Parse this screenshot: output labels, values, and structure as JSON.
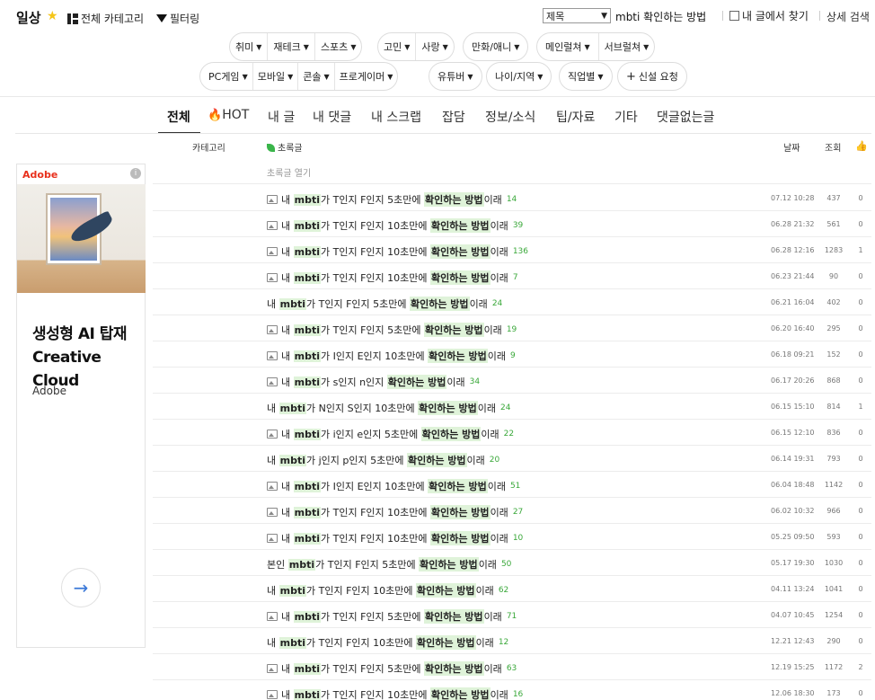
{
  "header": {
    "board_title": "일상",
    "all_categories": "전체 카테고리",
    "filter": "필터링",
    "search_field": "제목",
    "search_query": "mbti 확인하는 방법",
    "search_in_my_posts": "내 글에서 찾기",
    "advanced_search": "상세 검색"
  },
  "categories_row1": {
    "group1": [
      "취미",
      "재테크",
      "스포츠"
    ],
    "group2": [
      "고민",
      "사랑"
    ],
    "group3": [
      "만화/애니"
    ],
    "group4": [
      "메인럴쳐",
      "서브럴쳐"
    ]
  },
  "categories_row2": {
    "group1": [
      "PC게임",
      "모바일",
      "콘솔",
      "프로게이머"
    ],
    "group2": [
      "유튜버"
    ],
    "group3": [
      "나이/지역"
    ],
    "group4": [
      "직업별"
    ],
    "request": "신설 요청"
  },
  "tabs": [
    "전체",
    "HOT",
    "내 글",
    "내 댓글",
    "내 스크랩",
    "잡담",
    "정보/소식",
    "팁/자료",
    "기타",
    "댓글없는글"
  ],
  "list_header": {
    "category": "카테고리",
    "title": "초록글",
    "date": "날짜",
    "views": "조회"
  },
  "preview_toggle": "초록글 열기",
  "ad": {
    "logo": "Adobe",
    "info": "i",
    "headline": "생성형 AI 탑재 Creative Cloud",
    "brand": "Adobe",
    "arrow": "→"
  },
  "posts": [
    {
      "img": true,
      "pre": "내 ",
      "hl1": "mbti",
      "mid": "가 T인지 F인지 5초만에 ",
      "hl2": "확인하는 방법",
      "post": "이래",
      "comments": "14",
      "date": "07.12 10:28",
      "views": "437",
      "likes": "0"
    },
    {
      "img": true,
      "pre": "내 ",
      "hl1": "mbti",
      "mid": "가 T인지 F인지 10초만에 ",
      "hl2": "확인하는 방법",
      "post": "이래",
      "comments": "39",
      "date": "06.28 21:32",
      "views": "561",
      "likes": "0"
    },
    {
      "img": true,
      "pre": "내 ",
      "hl1": "mbti",
      "mid": "가 T인지 F인지 10초만에 ",
      "hl2": "확인하는 방법",
      "post": "이래",
      "comments": "136",
      "date": "06.28 12:16",
      "views": "1283",
      "likes": "1"
    },
    {
      "img": true,
      "pre": "내 ",
      "hl1": "mbti",
      "mid": "가 T인지 F인지 10초만에 ",
      "hl2": "확인하는 방법",
      "post": "이래",
      "comments": "7",
      "date": "06.23 21:44",
      "views": "90",
      "likes": "0"
    },
    {
      "img": false,
      "pre": "내 ",
      "hl1": "mbti",
      "mid": "가 T인지 F인지 5초만에 ",
      "hl2": "확인하는 방법",
      "post": "이래",
      "comments": "24",
      "date": "06.21 16:04",
      "views": "402",
      "likes": "0"
    },
    {
      "img": true,
      "pre": "내 ",
      "hl1": "mbti",
      "mid": "가 T인지 F인지 5초만에 ",
      "hl2": "확인하는 방법",
      "post": "이래",
      "comments": "19",
      "date": "06.20 16:40",
      "views": "295",
      "likes": "0"
    },
    {
      "img": true,
      "pre": "내 ",
      "hl1": "mbti",
      "mid": "가 I인지 E인지 10초만에 ",
      "hl2": "확인하는 방법",
      "post": "이래",
      "comments": "9",
      "date": "06.18 09:21",
      "views": "152",
      "likes": "0"
    },
    {
      "img": true,
      "pre": "내 ",
      "hl1": "mbti",
      "mid": "가 s인지 n인지 ",
      "hl2": "확인하는 방법",
      "post": "이래",
      "comments": "34",
      "date": "06.17 20:26",
      "views": "868",
      "likes": "0"
    },
    {
      "img": false,
      "pre": "내 ",
      "hl1": "mbti",
      "mid": "가 N인지 S인지 10초만에 ",
      "hl2": "확인하는 방법",
      "post": "이래",
      "comments": "24",
      "date": "06.15 15:10",
      "views": "814",
      "likes": "1"
    },
    {
      "img": true,
      "pre": "내 ",
      "hl1": "mbti",
      "mid": "가 i인지 e인지 5초만에 ",
      "hl2": "확인하는 방법",
      "post": "이래",
      "comments": "22",
      "date": "06.15 12:10",
      "views": "836",
      "likes": "0"
    },
    {
      "img": false,
      "pre": "내 ",
      "hl1": "mbti",
      "mid": "가 j인지 p인지 5초만에 ",
      "hl2": "확인하는 방법",
      "post": "이래",
      "comments": "20",
      "date": "06.14 19:31",
      "views": "793",
      "likes": "0"
    },
    {
      "img": true,
      "pre": "내 ",
      "hl1": "mbti",
      "mid": "가 I인지 E인지 10초만에 ",
      "hl2": "확인하는 방법",
      "post": "이래",
      "comments": "51",
      "date": "06.04 18:48",
      "views": "1142",
      "likes": "0"
    },
    {
      "img": true,
      "pre": "내 ",
      "hl1": "mbti",
      "mid": "가 T인지 F인지 10초만에 ",
      "hl2": "확인하는 방법",
      "post": "이래",
      "comments": "27",
      "date": "06.02 10:32",
      "views": "966",
      "likes": "0"
    },
    {
      "img": true,
      "pre": "내 ",
      "hl1": "mbti",
      "mid": "가 T인지 F인지 10초만에 ",
      "hl2": "확인하는 방법",
      "post": "이래",
      "comments": "10",
      "date": "05.25 09:50",
      "views": "593",
      "likes": "0"
    },
    {
      "img": false,
      "pre": "본인 ",
      "hl1": "mbti",
      "mid": "가 T인지 F인지 5초만에 ",
      "hl2": "확인하는 방법",
      "post": "이래",
      "comments": "50",
      "date": "05.17 19:30",
      "views": "1030",
      "likes": "0"
    },
    {
      "img": false,
      "pre": "내 ",
      "hl1": "mbti",
      "mid": "가 T인지 F인지 10초만에 ",
      "hl2": "확인하는 방법",
      "post": "이래",
      "comments": "62",
      "date": "04.11 13:24",
      "views": "1041",
      "likes": "0"
    },
    {
      "img": true,
      "pre": "내 ",
      "hl1": "mbti",
      "mid": "가 T인지 F인지 5초만에 ",
      "hl2": "확인하는 방법",
      "post": "이래",
      "comments": "71",
      "date": "04.07 10:45",
      "views": "1254",
      "likes": "0"
    },
    {
      "img": false,
      "pre": "내 ",
      "hl1": "mbti",
      "mid": "가 T인지 F인지 10초만에 ",
      "hl2": "확인하는 방법",
      "post": "이래",
      "comments": "12",
      "date": "12.21 12:43",
      "views": "290",
      "likes": "0"
    },
    {
      "img": true,
      "pre": "내 ",
      "hl1": "mbti",
      "mid": "가 T인지 F인지 5초만에 ",
      "hl2": "확인하는 방법",
      "post": "이래",
      "comments": "63",
      "date": "12.19 15:25",
      "views": "1172",
      "likes": "2"
    },
    {
      "img": true,
      "pre": "내 ",
      "hl1": "mbti",
      "mid": "가 T인지 F인지 10초만에 ",
      "hl2": "확인하는 방법",
      "post": "이래",
      "comments": "16",
      "date": "12.06 18:30",
      "views": "173",
      "likes": "0"
    }
  ],
  "colors": {
    "highlight": "#dff3d9",
    "comment_count": "#3aa83a",
    "hot_fire": "#e8432e",
    "star": "#f5c518",
    "adobe_red": "#e8301c"
  }
}
